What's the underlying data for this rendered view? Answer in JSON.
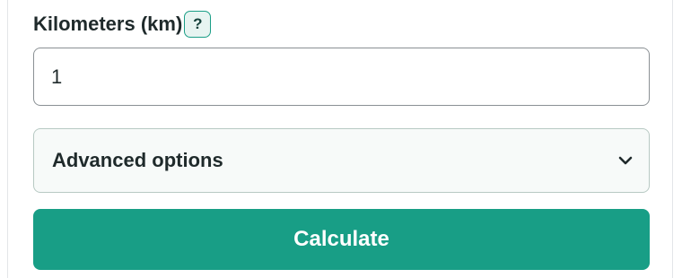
{
  "field": {
    "label": "Kilometers (km)",
    "help": "?",
    "value": "1"
  },
  "advanced": {
    "label": "Advanced options",
    "icon": "chevron-down-icon"
  },
  "actions": {
    "calculate_label": "Calculate"
  },
  "colors": {
    "accent": "#189e86",
    "help_badge_bg": "#e7f4f1",
    "text": "#1f2a2b"
  }
}
